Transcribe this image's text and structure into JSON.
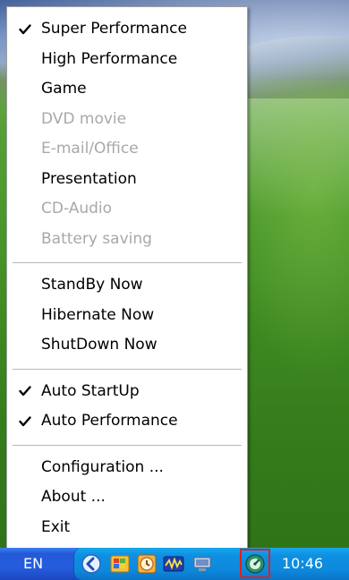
{
  "menu": {
    "groups": [
      [
        {
          "label": "Super Performance",
          "checked": true,
          "enabled": true
        },
        {
          "label": "High Performance",
          "checked": false,
          "enabled": true
        },
        {
          "label": "Game",
          "checked": false,
          "enabled": true
        },
        {
          "label": "DVD movie",
          "checked": false,
          "enabled": false
        },
        {
          "label": "E-mail/Office",
          "checked": false,
          "enabled": false
        },
        {
          "label": "Presentation",
          "checked": false,
          "enabled": true
        },
        {
          "label": "CD-Audio",
          "checked": false,
          "enabled": false
        },
        {
          "label": "Battery saving",
          "checked": false,
          "enabled": false
        }
      ],
      [
        {
          "label": "StandBy Now",
          "checked": false,
          "enabled": true
        },
        {
          "label": "Hibernate Now",
          "checked": false,
          "enabled": true
        },
        {
          "label": "ShutDown Now",
          "checked": false,
          "enabled": true
        }
      ],
      [
        {
          "label": "Auto StartUp",
          "checked": true,
          "enabled": true
        },
        {
          "label": "Auto Performance",
          "checked": true,
          "enabled": true
        }
      ],
      [
        {
          "label": "Configuration ...",
          "checked": false,
          "enabled": true
        },
        {
          "label": "About ...",
          "checked": false,
          "enabled": true
        },
        {
          "label": "Exit",
          "checked": false,
          "enabled": true
        }
      ]
    ]
  },
  "taskbar": {
    "language": "EN",
    "clock": "10:46",
    "tray_icons": [
      "chevron-left-icon",
      "windows-flag-icon",
      "clock-icon",
      "graph-icon",
      "network-icon",
      "performance-app-icon"
    ]
  },
  "colors": {
    "highlight_box": "#e02020",
    "taskbar": "#245dde",
    "tray": "#0d89dc",
    "disabled_text": "#a8a8a8"
  }
}
